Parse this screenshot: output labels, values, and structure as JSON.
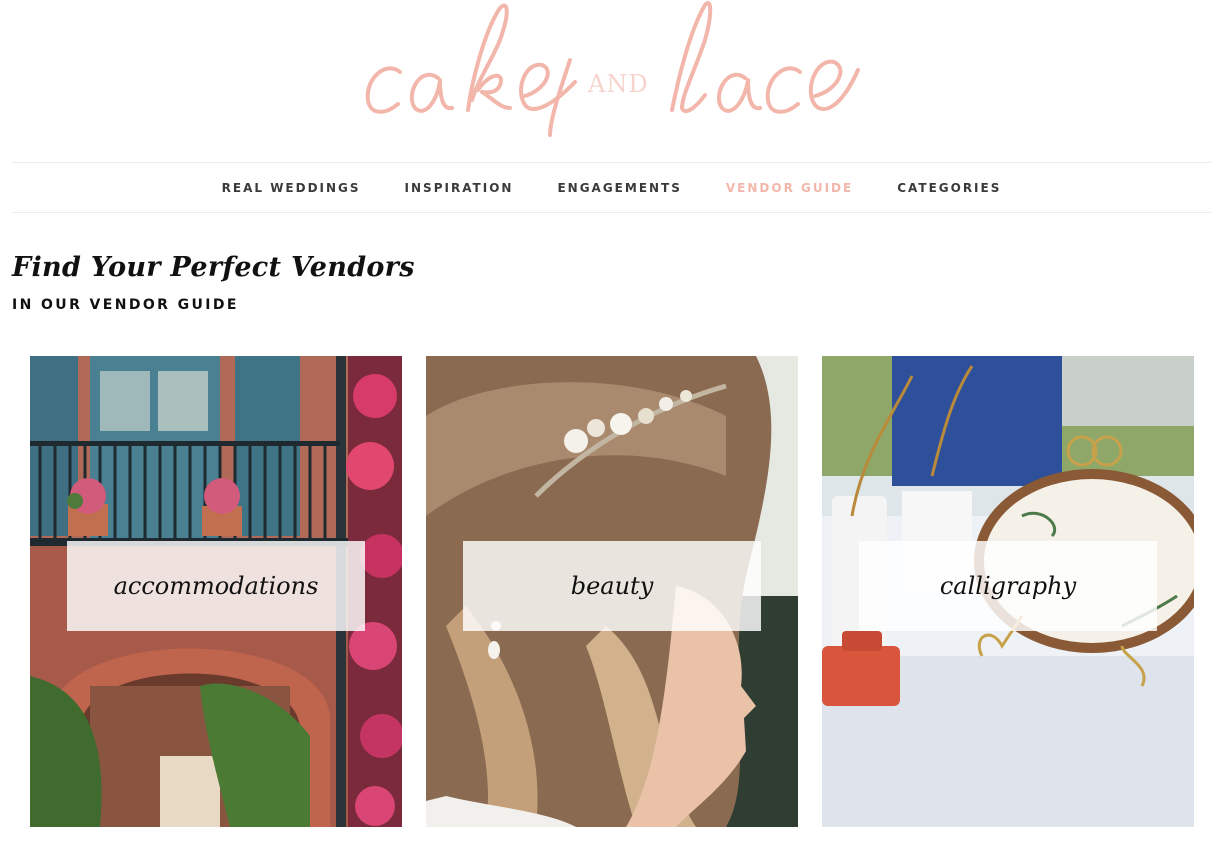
{
  "logo": {
    "text": "cake and lace",
    "part1": "cake",
    "connector": "AND",
    "part2": "lace",
    "color": "#f2b6ab"
  },
  "nav": {
    "items": [
      {
        "label": "REAL WEDDINGS",
        "active": false
      },
      {
        "label": "INSPIRATION",
        "active": false
      },
      {
        "label": "ENGAGEMENTS",
        "active": false
      },
      {
        "label": "VENDOR GUIDE",
        "active": true
      },
      {
        "label": "CATEGORIES",
        "active": false
      }
    ],
    "active_color": "#f2b6ab"
  },
  "heading": {
    "title": "Find Your Perfect Vendors",
    "subtitle": "IN OUR VENDOR GUIDE"
  },
  "cards": [
    {
      "label": "accommodations",
      "image": "building-with-balcony-and-brick-arch-photo"
    },
    {
      "label": "beauty",
      "image": "woman-with-jeweled-headband-photo"
    },
    {
      "label": "calligraphy",
      "image": "wood-slice-sign-on-table-photo"
    }
  ]
}
